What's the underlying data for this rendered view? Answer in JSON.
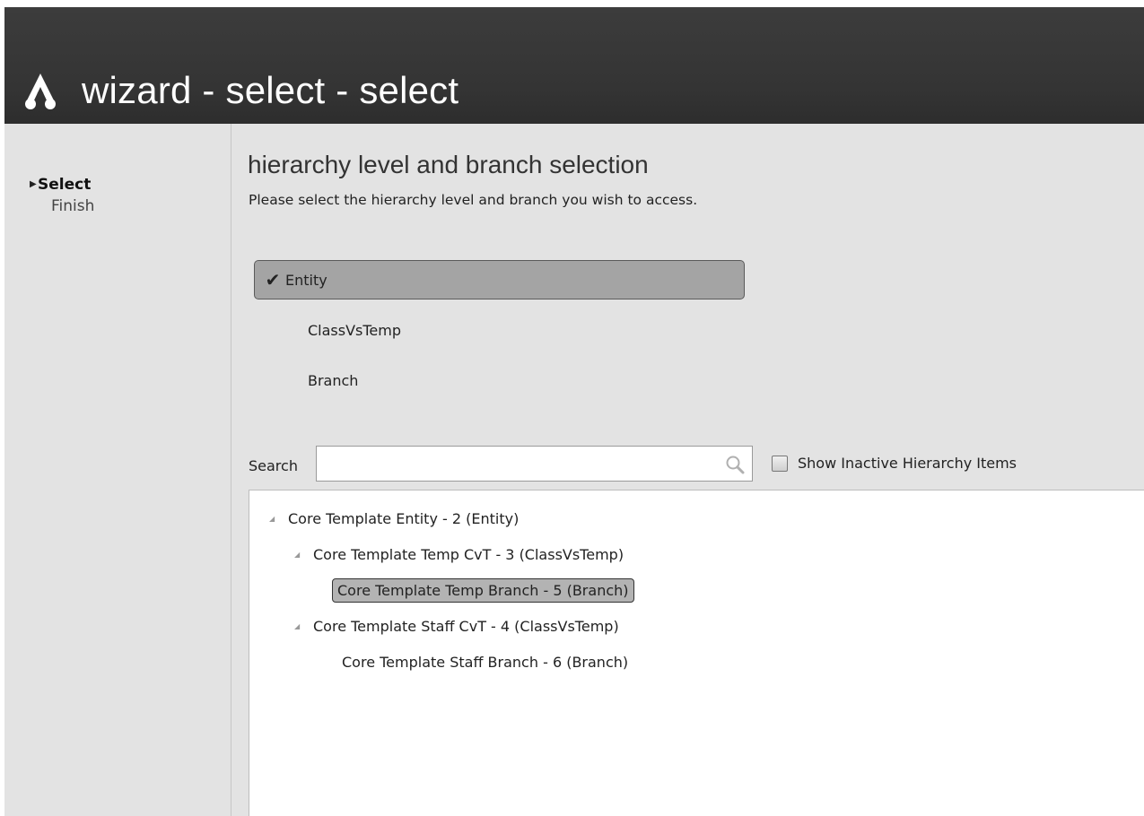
{
  "window": {
    "title": "wizard - select - select"
  },
  "sidebar": {
    "steps": [
      {
        "label": "Select",
        "state": "active"
      },
      {
        "label": "Finish",
        "state": "pending"
      }
    ]
  },
  "main": {
    "heading": "hierarchy level and branch selection",
    "subheading": "Please select the hierarchy level and branch you wish to access.",
    "levels": [
      {
        "label": "Entity",
        "selected": true
      },
      {
        "label": "ClassVsTemp",
        "selected": false
      },
      {
        "label": "Branch",
        "selected": false
      }
    ],
    "search": {
      "label": "Search",
      "value": "",
      "placeholder": ""
    },
    "show_inactive": {
      "label": "Show Inactive Hierarchy Items",
      "checked": false
    },
    "tree": [
      {
        "label": "Core Template Entity - 2 (Entity)",
        "depth": 0,
        "expanded": true
      },
      {
        "label": "Core Template Temp CvT - 3 (ClassVsTemp)",
        "depth": 1,
        "expanded": true
      },
      {
        "label": "Core Template Temp Branch - 5 (Branch)",
        "depth": 2,
        "selected": true
      },
      {
        "label": "Core Template Staff CvT - 4 (ClassVsTemp)",
        "depth": 1,
        "expanded": true
      },
      {
        "label": "Core Template Staff Branch - 6 (Branch)",
        "depth": 2
      }
    ]
  },
  "icons": {
    "app_logo": "app-logo-icon",
    "step_marker": "triangle-right-icon",
    "check": "checkmark-icon",
    "search": "magnifier-icon",
    "tree_expand": "triangle-expanded-icon"
  },
  "colors": {
    "header_bg": "#333333",
    "content_bg": "#e3e3e3",
    "selected_bg": "#a4a4a4"
  }
}
